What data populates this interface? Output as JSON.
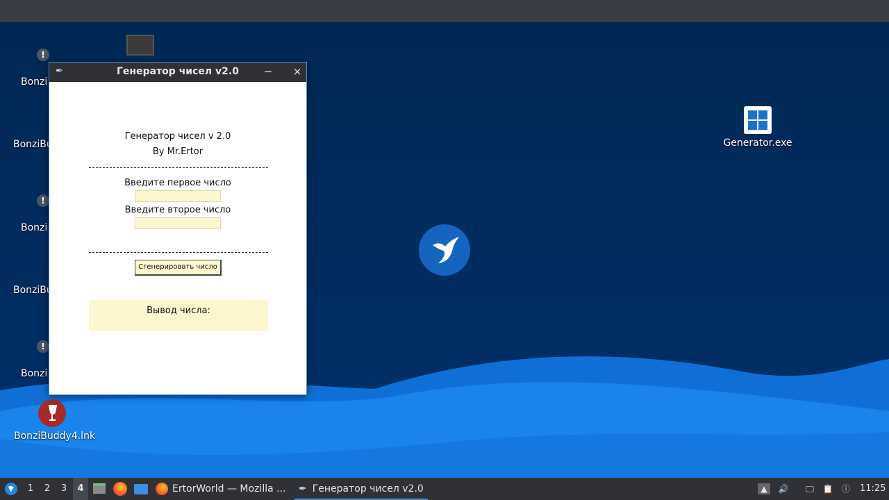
{
  "desktop": {
    "icons": [
      {
        "label": "Bonzi"
      },
      {
        "label": "BonziBu"
      },
      {
        "label": "Bonzi"
      },
      {
        "label": "BonziBu"
      },
      {
        "label": "Bonzi"
      },
      {
        "label": "BonziBuddy4.lnk"
      },
      {
        "label": "Generator.exe"
      }
    ]
  },
  "window": {
    "title": "Генератор чисел v2.0",
    "minimize_glyph": "−",
    "close_glyph": "×",
    "header_line1": "Генератор чисел v 2.0",
    "header_line2": "By Mr.Ertor",
    "first_label": "Введите первое число",
    "first_value": "",
    "second_label": "Введите второе число",
    "second_value": "",
    "generate_button": "Сгенерировать число",
    "output_label": "Вывод числа:"
  },
  "taskbar": {
    "workspaces": [
      "1",
      "2",
      "3",
      "4"
    ],
    "active_workspace": "4",
    "tasks": [
      {
        "label": "ErtorWorld — Mozilla ..."
      },
      {
        "label": "Генератор чисел v2.0"
      }
    ],
    "clock": "11:25"
  },
  "colors": {
    "desktop_bg": "#00264f",
    "wave_light": "#1e88e5",
    "taskbar_bg": "#2f3136",
    "field_bg": "#fdf7cf",
    "accent": "#4a90d9"
  }
}
